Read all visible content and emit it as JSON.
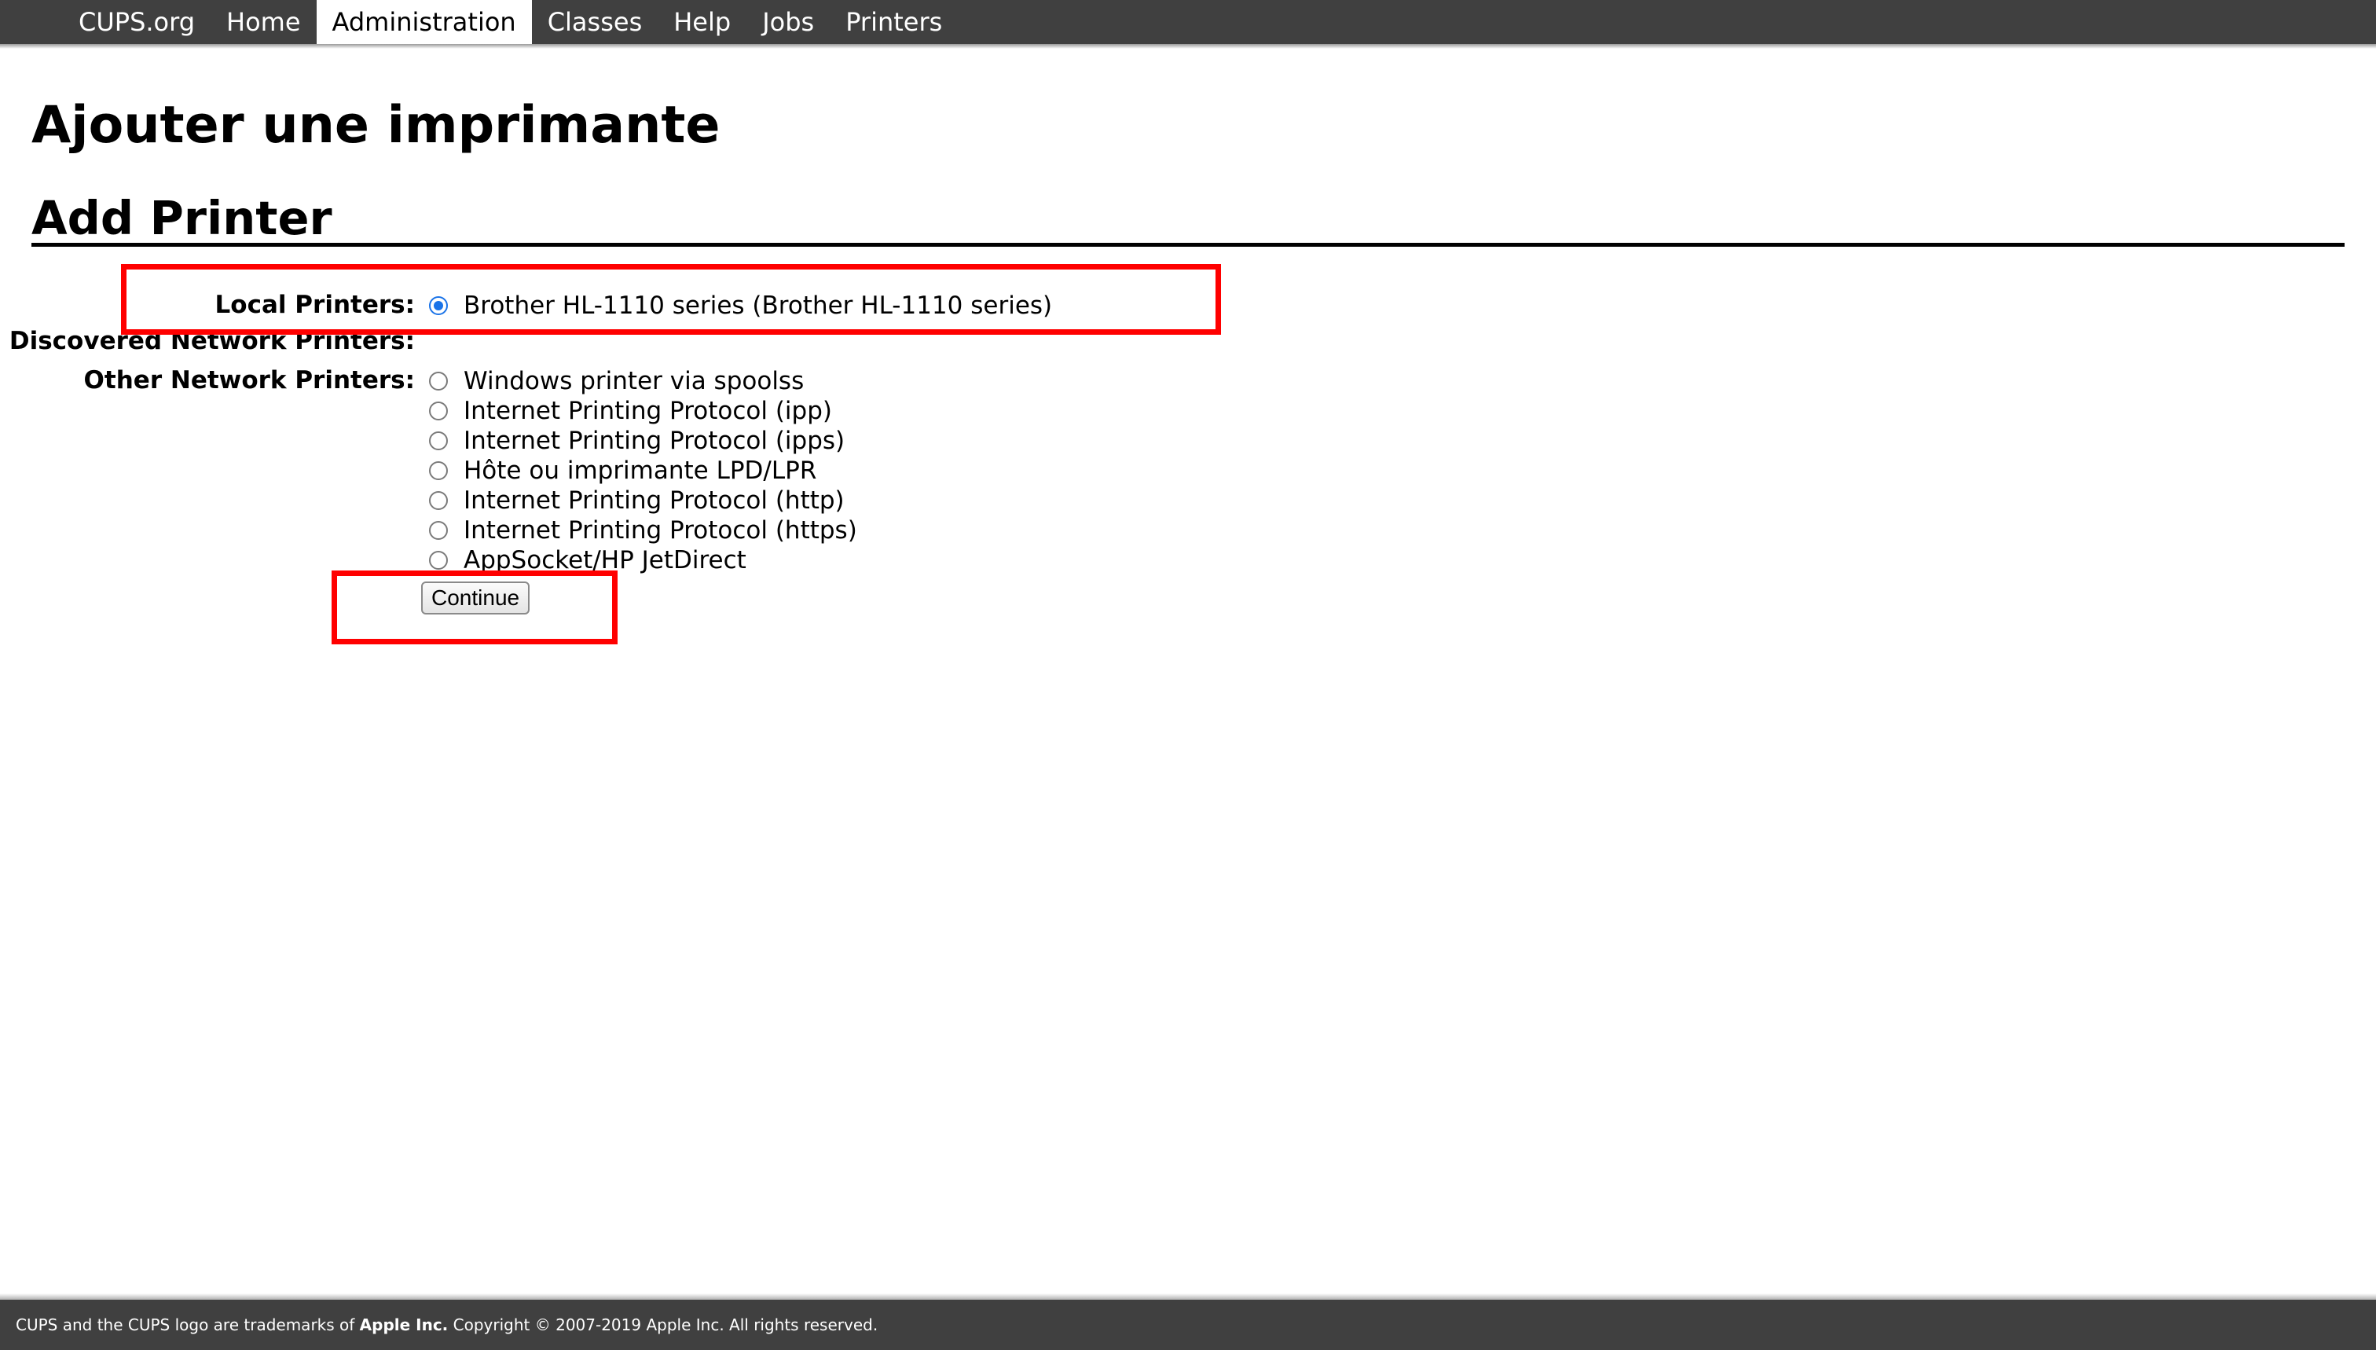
{
  "nav": {
    "items": [
      {
        "label": "CUPS.org"
      },
      {
        "label": "Home"
      },
      {
        "label": "Administration"
      },
      {
        "label": "Classes"
      },
      {
        "label": "Help"
      },
      {
        "label": "Jobs"
      },
      {
        "label": "Printers"
      }
    ],
    "active": "Administration"
  },
  "headings": {
    "page_title": "Ajouter une imprimante",
    "section_title": "Add Printer"
  },
  "form": {
    "local_label": "Local Printers:",
    "discovered_label": "Discovered Network Printers:",
    "other_label": "Other Network Printers:",
    "local_options": [
      {
        "label": "Brother HL-1110 series (Brother HL-1110 series)",
        "checked": true
      }
    ],
    "other_options": [
      {
        "label": "Windows printer via spoolss",
        "checked": false
      },
      {
        "label": "Internet Printing Protocol (ipp)",
        "checked": false
      },
      {
        "label": "Internet Printing Protocol (ipps)",
        "checked": false
      },
      {
        "label": "Hôte ou imprimante LPD/LPR",
        "checked": false
      },
      {
        "label": "Internet Printing Protocol (http)",
        "checked": false
      },
      {
        "label": "Internet Printing Protocol (https)",
        "checked": false
      },
      {
        "label": "AppSocket/HP JetDirect",
        "checked": false
      }
    ],
    "continue_label": "Continue"
  },
  "footer": {
    "text_before": "CUPS and the CUPS logo are trademarks of ",
    "brand": "Apple Inc.",
    "text_after": " Copyright © 2007-2019 Apple Inc. All rights reserved."
  },
  "colors": {
    "bar_background": "#404040",
    "radio_accent": "#1a73e8",
    "annotation_red": "#ff0000"
  }
}
